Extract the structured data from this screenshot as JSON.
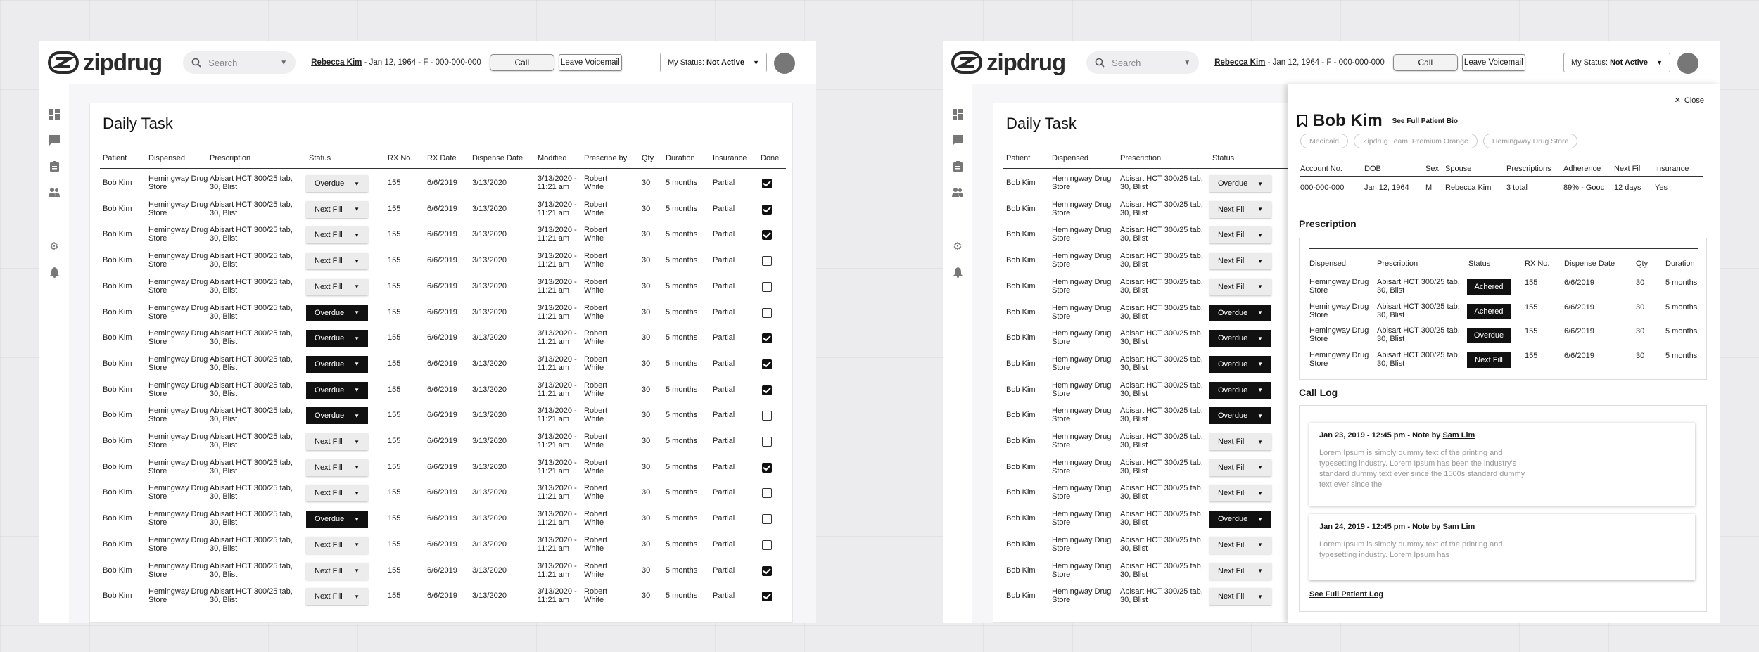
{
  "app": {
    "logo_text": "zipdrug"
  },
  "header": {
    "search_placeholder": "Search",
    "patient_name": "Rebecca Kim",
    "patient_details": " - Jan 12, 1964 - F - 000-000-000",
    "call_label": "Call",
    "voicemail_label": "Leave Voicemail",
    "status_label": "My Status:",
    "status_value": "Not Active"
  },
  "task": {
    "title": "Daily Task",
    "columns": [
      "Patient",
      "Dispensed",
      "Prescription",
      "Status",
      "RX No.",
      "RX Date",
      "Dispense Date",
      "Modified",
      "Prescribe by",
      "Qty",
      "Duration",
      "Insurance",
      "Done"
    ],
    "rows": [
      {
        "patient": "Bob Kim",
        "dispensed": "Hemingway Drug Store",
        "prescription": "Abisart HCT 300/25 tab, 30, Blist",
        "status": "Overdue",
        "dark": false,
        "rx_no": "155",
        "rx_date": "6/6/2019",
        "dispense_date": "3/13/2020",
        "modified": "3/13/2020 - 11:21 am",
        "prescriber": "Robert White",
        "qty": "30",
        "duration": "5 months",
        "insurance": "Partial",
        "done": true
      },
      {
        "patient": "Bob Kim",
        "dispensed": "Hemingway Drug Store",
        "prescription": "Abisart HCT 300/25 tab, 30, Blist",
        "status": "Next Fill",
        "dark": false,
        "rx_no": "155",
        "rx_date": "6/6/2019",
        "dispense_date": "3/13/2020",
        "modified": "3/13/2020 - 11:21 am",
        "prescriber": "Robert White",
        "qty": "30",
        "duration": "5 months",
        "insurance": "Partial",
        "done": true
      },
      {
        "patient": "Bob Kim",
        "dispensed": "Hemingway Drug Store",
        "prescription": "Abisart HCT 300/25 tab, 30, Blist",
        "status": "Next Fill",
        "dark": false,
        "rx_no": "155",
        "rx_date": "6/6/2019",
        "dispense_date": "3/13/2020",
        "modified": "3/13/2020 - 11:21 am",
        "prescriber": "Robert White",
        "qty": "30",
        "duration": "5 months",
        "insurance": "Partial",
        "done": true
      },
      {
        "patient": "Bob Kim",
        "dispensed": "Hemingway Drug Store",
        "prescription": "Abisart HCT 300/25 tab, 30, Blist",
        "status": "Next Fill",
        "dark": false,
        "rx_no": "155",
        "rx_date": "6/6/2019",
        "dispense_date": "3/13/2020",
        "modified": "3/13/2020 - 11:21 am",
        "prescriber": "Robert White",
        "qty": "30",
        "duration": "5 months",
        "insurance": "Partial",
        "done": false
      },
      {
        "patient": "Bob Kim",
        "dispensed": "Hemingway Drug Store",
        "prescription": "Abisart HCT 300/25 tab, 30, Blist",
        "status": "Next Fill",
        "dark": false,
        "rx_no": "155",
        "rx_date": "6/6/2019",
        "dispense_date": "3/13/2020",
        "modified": "3/13/2020 - 11:21 am",
        "prescriber": "Robert White",
        "qty": "30",
        "duration": "5 months",
        "insurance": "Partial",
        "done": false
      },
      {
        "patient": "Bob Kim",
        "dispensed": "Hemingway Drug Store",
        "prescription": "Abisart HCT 300/25 tab, 30, Blist",
        "status": "Overdue",
        "dark": true,
        "rx_no": "155",
        "rx_date": "6/6/2019",
        "dispense_date": "3/13/2020",
        "modified": "3/13/2020 - 11:21 am",
        "prescriber": "Robert White",
        "qty": "30",
        "duration": "5 months",
        "insurance": "Partial",
        "done": false
      },
      {
        "patient": "Bob Kim",
        "dispensed": "Hemingway Drug Store",
        "prescription": "Abisart HCT 300/25 tab, 30, Blist",
        "status": "Overdue",
        "dark": true,
        "rx_no": "155",
        "rx_date": "6/6/2019",
        "dispense_date": "3/13/2020",
        "modified": "3/13/2020 - 11:21 am",
        "prescriber": "Robert White",
        "qty": "30",
        "duration": "5 months",
        "insurance": "Partial",
        "done": true
      },
      {
        "patient": "Bob Kim",
        "dispensed": "Hemingway Drug Store",
        "prescription": "Abisart HCT 300/25 tab, 30, Blist",
        "status": "Overdue",
        "dark": true,
        "rx_no": "155",
        "rx_date": "6/6/2019",
        "dispense_date": "3/13/2020",
        "modified": "3/13/2020 - 11:21 am",
        "prescriber": "Robert White",
        "qty": "30",
        "duration": "5 months",
        "insurance": "Partial",
        "done": true
      },
      {
        "patient": "Bob Kim",
        "dispensed": "Hemingway Drug Store",
        "prescription": "Abisart HCT 300/25 tab, 30, Blist",
        "status": "Overdue",
        "dark": true,
        "rx_no": "155",
        "rx_date": "6/6/2019",
        "dispense_date": "3/13/2020",
        "modified": "3/13/2020 - 11:21 am",
        "prescriber": "Robert White",
        "qty": "30",
        "duration": "5 months",
        "insurance": "Partial",
        "done": true
      },
      {
        "patient": "Bob Kim",
        "dispensed": "Hemingway Drug Store",
        "prescription": "Abisart HCT 300/25 tab, 30, Blist",
        "status": "Overdue",
        "dark": true,
        "rx_no": "155",
        "rx_date": "6/6/2019",
        "dispense_date": "3/13/2020",
        "modified": "3/13/2020 - 11:21 am",
        "prescriber": "Robert White",
        "qty": "30",
        "duration": "5 months",
        "insurance": "Partial",
        "done": false
      },
      {
        "patient": "Bob Kim",
        "dispensed": "Hemingway Drug Store",
        "prescription": "Abisart HCT 300/25 tab, 30, Blist",
        "status": "Next Fill",
        "dark": false,
        "rx_no": "155",
        "rx_date": "6/6/2019",
        "dispense_date": "3/13/2020",
        "modified": "3/13/2020 - 11:21 am",
        "prescriber": "Robert White",
        "qty": "30",
        "duration": "5 months",
        "insurance": "Partial",
        "done": false
      },
      {
        "patient": "Bob Kim",
        "dispensed": "Hemingway Drug Store",
        "prescription": "Abisart HCT 300/25 tab, 30, Blist",
        "status": "Next Fill",
        "dark": false,
        "rx_no": "155",
        "rx_date": "6/6/2019",
        "dispense_date": "3/13/2020",
        "modified": "3/13/2020 - 11:21 am",
        "prescriber": "Robert White",
        "qty": "30",
        "duration": "5 months",
        "insurance": "Partial",
        "done": true
      },
      {
        "patient": "Bob Kim",
        "dispensed": "Hemingway Drug Store",
        "prescription": "Abisart HCT 300/25 tab, 30, Blist",
        "status": "Next Fill",
        "dark": false,
        "rx_no": "155",
        "rx_date": "6/6/2019",
        "dispense_date": "3/13/2020",
        "modified": "3/13/2020 - 11:21 am",
        "prescriber": "Robert White",
        "qty": "30",
        "duration": "5 months",
        "insurance": "Partial",
        "done": false
      },
      {
        "patient": "Bob Kim",
        "dispensed": "Hemingway Drug Store",
        "prescription": "Abisart HCT 300/25 tab, 30, Blist",
        "status": "Overdue",
        "dark": true,
        "rx_no": "155",
        "rx_date": "6/6/2019",
        "dispense_date": "3/13/2020",
        "modified": "3/13/2020 - 11:21 am",
        "prescriber": "Robert White",
        "qty": "30",
        "duration": "5 months",
        "insurance": "Partial",
        "done": false
      },
      {
        "patient": "Bob Kim",
        "dispensed": "Hemingway Drug Store",
        "prescription": "Abisart HCT 300/25 tab, 30, Blist",
        "status": "Next Fill",
        "dark": false,
        "rx_no": "155",
        "rx_date": "6/6/2019",
        "dispense_date": "3/13/2020",
        "modified": "3/13/2020 - 11:21 am",
        "prescriber": "Robert White",
        "qty": "30",
        "duration": "5 months",
        "insurance": "Partial",
        "done": false
      },
      {
        "patient": "Bob Kim",
        "dispensed": "Hemingway Drug Store",
        "prescription": "Abisart HCT 300/25 tab, 30, Blist",
        "status": "Next Fill",
        "dark": false,
        "rx_no": "155",
        "rx_date": "6/6/2019",
        "dispense_date": "3/13/2020",
        "modified": "3/13/2020 - 11:21 am",
        "prescriber": "Robert White",
        "qty": "30",
        "duration": "5 months",
        "insurance": "Partial",
        "done": true
      },
      {
        "patient": "Bob Kim",
        "dispensed": "Hemingway Drug Store",
        "prescription": "Abisart HCT 300/25 tab, 30, Blist",
        "status": "Next Fill",
        "dark": false,
        "rx_no": "155",
        "rx_date": "6/6/2019",
        "dispense_date": "3/13/2020",
        "modified": "3/13/2020 - 11:21 am",
        "prescriber": "Robert White",
        "qty": "30",
        "duration": "5 months",
        "insurance": "Partial",
        "done": true
      }
    ]
  },
  "patient_panel": {
    "close_label": "Close",
    "name": "Bob Kim",
    "bio_link": "See Full Patient Bio",
    "tags": [
      "Medicaid",
      "Zipdrug Team: Premium Orange",
      "Hemingway Drug Store"
    ],
    "info_headers": [
      "Account No.",
      "DOB",
      "Sex",
      "Spouse",
      "Prescriptions",
      "Adherence",
      "Next Fill",
      "Insurance"
    ],
    "info_values": [
      "000-000-000",
      "Jan 12, 1964",
      "M",
      "Rebecca Kim",
      "3 total",
      "89% - Good",
      "12 days",
      "Yes"
    ],
    "prescription_title": "Prescription",
    "rx_headers": [
      "Dispensed",
      "Prescription",
      "Status",
      "RX No.",
      "Dispense Date",
      "Qty",
      "Duration"
    ],
    "rx_rows": [
      {
        "dispensed": "Hemingway Drug Store",
        "prescription": "Abisart HCT 300/25 tab, 30, Blist",
        "status": "Achered",
        "rx_no": "155",
        "dispense_date": "6/6/2019",
        "qty": "30",
        "duration": "5 months"
      },
      {
        "dispensed": "Hemingway Drug Store",
        "prescription": "Abisart HCT 300/25 tab, 30, Blist",
        "status": "Achered",
        "rx_no": "155",
        "dispense_date": "6/6/2019",
        "qty": "30",
        "duration": "5 months"
      },
      {
        "dispensed": "Hemingway Drug Store",
        "prescription": "Abisart HCT 300/25 tab, 30, Blist",
        "status": "Overdue",
        "rx_no": "155",
        "dispense_date": "6/6/2019",
        "qty": "30",
        "duration": "5 months"
      },
      {
        "dispensed": "Hemingway Drug Store",
        "prescription": "Abisart HCT 300/25 tab, 30, Blist",
        "status": "Next Fill",
        "rx_no": "155",
        "dispense_date": "6/6/2019",
        "qty": "30",
        "duration": "5 months"
      }
    ],
    "call_log_title": "Call Log",
    "notes": [
      {
        "heading": "Jan 23, 2019 - 12:45 pm - Note by ",
        "author": "Sam Lim",
        "body": "Lorem Ipsum is simply dummy text of the printing and typesetting industry. Lorem Ipsum has been the industry's standard dummy text ever since the 1500s standard dummy text ever since the"
      },
      {
        "heading": "Jan 24, 2019 - 12:45 pm - Note by ",
        "author": "Sam Lim",
        "body": "Lorem Ipsum is simply dummy text of the printing and typesetting industry. Lorem Ipsum has"
      }
    ],
    "log_link": "See Full Patient Log"
  }
}
